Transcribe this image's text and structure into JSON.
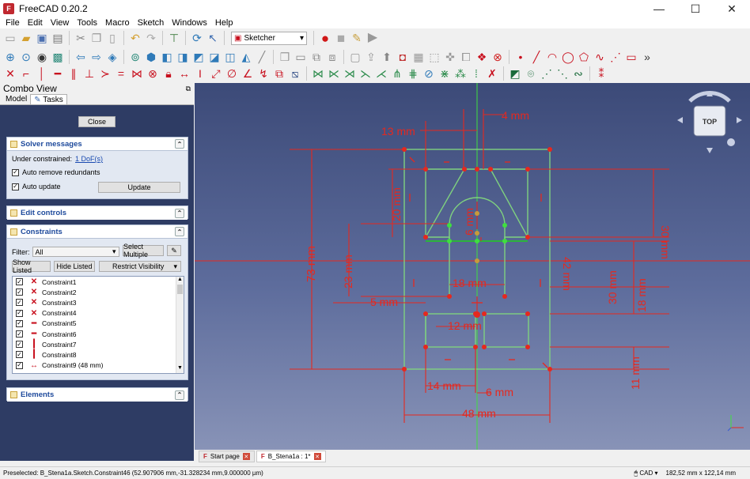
{
  "window": {
    "title": "FreeCAD 0.20.2",
    "minimize": "—",
    "maximize": "☐",
    "close": "✕"
  },
  "menu": [
    "File",
    "Edit",
    "View",
    "Tools",
    "Macro",
    "Sketch",
    "Windows",
    "Help"
  ],
  "toolbar": {
    "workbench": "Sketcher"
  },
  "combo_view": {
    "title": "Combo View",
    "tabs": [
      "Model",
      "Tasks"
    ],
    "close_button": "Close",
    "solver": {
      "header": "Solver messages",
      "status_prefix": "Under constrained:",
      "status_link": "1 DoF(s)",
      "auto_remove": "Auto remove redundants",
      "auto_update": "Auto update",
      "update_button": "Update"
    },
    "edit_controls": {
      "header": "Edit controls"
    },
    "constraints": {
      "header": "Constraints",
      "filter_label": "Filter:",
      "filter_value": "All",
      "select_multiple": "Select Multiple",
      "show_listed": "Show Listed",
      "hide_listed": "Hide Listed",
      "restrict_visibility": "Restrict Visibility",
      "items": [
        {
          "label": "Constraint1",
          "icon": "coincident-icon"
        },
        {
          "label": "Constraint2",
          "icon": "coincident-icon"
        },
        {
          "label": "Constraint3",
          "icon": "coincident-icon"
        },
        {
          "label": "Constraint4",
          "icon": "coincident-icon"
        },
        {
          "label": "Constraint5",
          "icon": "horizontal-icon"
        },
        {
          "label": "Constraint6",
          "icon": "horizontal-icon"
        },
        {
          "label": "Constraint7",
          "icon": "vertical-icon"
        },
        {
          "label": "Constraint8",
          "icon": "vertical-icon"
        },
        {
          "label": "Constraint9 (48 mm)",
          "icon": "horizontal-distance-icon"
        }
      ]
    },
    "elements": {
      "header": "Elements"
    }
  },
  "viewport": {
    "navcube_face": "TOP",
    "dimensions": [
      "4 mm",
      "13 mm",
      "20 mm",
      "30 mm",
      "73 mm",
      "23 mm",
      "6 mm",
      "18 mm",
      "42 mm",
      "30 mm",
      "18 mm",
      "5 mm",
      "12 mm",
      "11 mm",
      "14 mm",
      "6 mm",
      "48 mm"
    ]
  },
  "doc_tabs": [
    {
      "label": "Start page",
      "active": false
    },
    {
      "label": "B_Stena1a : 1*",
      "active": true
    }
  ],
  "status": {
    "preselected": "Preselected: B_Stena1a.Sketch.Constraint46 (52.907906 mm,-31.328234 mm,9.000000 µm)",
    "nav_style": "CAD",
    "dimensions": "182,52 mm x 122,14 mm"
  },
  "colors": {
    "viewport_top": "#3c4a78",
    "viewport_bottom": "#8893b7",
    "constraint_red": "#e6281e",
    "geometry_green": "#7fd17f",
    "task_bg": "#2e3c64",
    "panel_header_text": "#1e4a9c"
  }
}
